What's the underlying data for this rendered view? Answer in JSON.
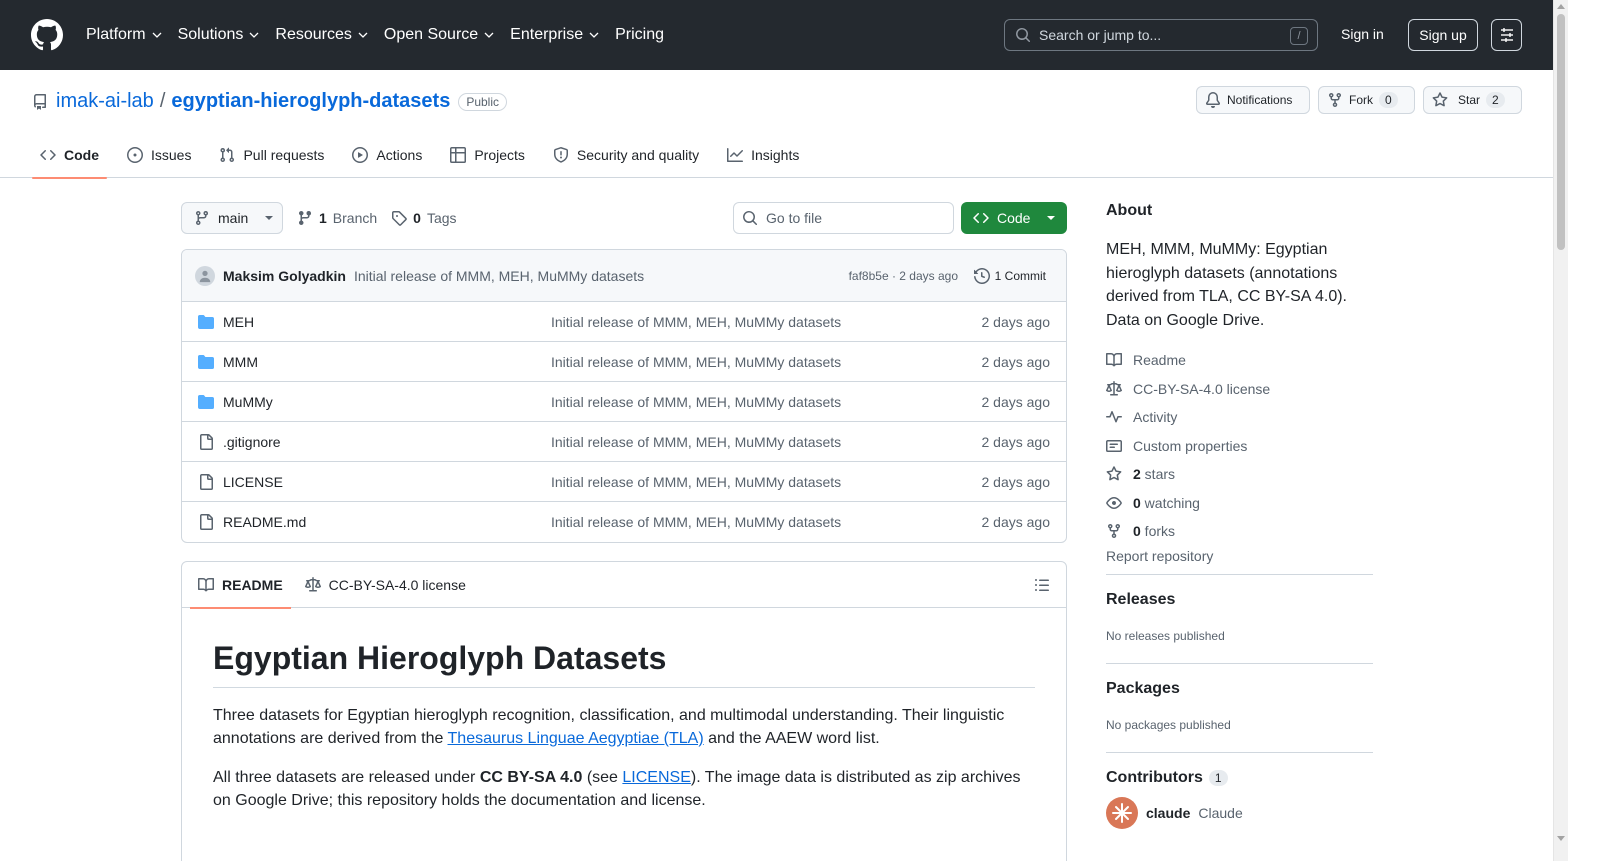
{
  "header": {
    "nav": [
      {
        "label": "Platform",
        "has_menu": true
      },
      {
        "label": "Solutions",
        "has_menu": true
      },
      {
        "label": "Resources",
        "has_menu": true
      },
      {
        "label": "Open Source",
        "has_menu": true
      },
      {
        "label": "Enterprise",
        "has_menu": true
      },
      {
        "label": "Pricing",
        "has_menu": false
      }
    ],
    "search_placeholder": "Search or jump to...",
    "search_shortcut": "/",
    "sign_in": "Sign in",
    "sign_up": "Sign up"
  },
  "repo": {
    "owner": "imak-ai-lab",
    "separator": "/",
    "name": "egyptian-hieroglyph-datasets",
    "visibility": "Public",
    "actions": {
      "notifications": "Notifications",
      "fork": "Fork",
      "fork_count": "0",
      "star": "Star",
      "star_count": "2"
    },
    "tabs": [
      {
        "label": "Code",
        "icon": "code-icon",
        "active": true
      },
      {
        "label": "Issues",
        "icon": "issue-icon",
        "active": false
      },
      {
        "label": "Pull requests",
        "icon": "pull-request-icon",
        "active": false
      },
      {
        "label": "Actions",
        "icon": "play-icon",
        "active": false
      },
      {
        "label": "Projects",
        "icon": "table-icon",
        "active": false
      },
      {
        "label": "Security and quality",
        "icon": "shield-icon",
        "active": false
      },
      {
        "label": "Insights",
        "icon": "graph-icon",
        "active": false
      }
    ]
  },
  "toolbar": {
    "branch": "main",
    "branch_count": "1",
    "branch_label": "Branch",
    "tag_count": "0",
    "tag_label": "Tags",
    "goto_placeholder": "Go to file",
    "code_button": "Code"
  },
  "commit": {
    "author": "Maksim Golyadkin",
    "message": "Initial release of MMM, MEH, MuMMy datasets",
    "hash": "faf8b5e",
    "time": "2 days ago",
    "hash_time": "faf8b5e · 2 days ago",
    "commit_count_label": "1 Commit"
  },
  "files": [
    {
      "name": "MEH",
      "type": "folder",
      "message": "Initial release of MMM, MEH, MuMMy datasets",
      "date": "2 days ago"
    },
    {
      "name": "MMM",
      "type": "folder",
      "message": "Initial release of MMM, MEH, MuMMy datasets",
      "date": "2 days ago"
    },
    {
      "name": "MuMMy",
      "type": "folder",
      "message": "Initial release of MMM, MEH, MuMMy datasets",
      "date": "2 days ago"
    },
    {
      "name": ".gitignore",
      "type": "file",
      "message": "Initial release of MMM, MEH, MuMMy datasets",
      "date": "2 days ago"
    },
    {
      "name": "LICENSE",
      "type": "file",
      "message": "Initial release of MMM, MEH, MuMMy datasets",
      "date": "2 days ago"
    },
    {
      "name": "README.md",
      "type": "file",
      "message": "Initial release of MMM, MEH, MuMMy datasets",
      "date": "2 days ago"
    }
  ],
  "readme": {
    "tab_readme": "README",
    "tab_license": "CC-BY-SA-4.0 license",
    "title": "Egyptian Hieroglyph Datasets",
    "p1_before": "Three datasets for Egyptian hieroglyph recognition, classification, and multimodal understanding. Their linguistic annotations are derived from the ",
    "p1_link": "Thesaurus Linguae Aegyptiae (TLA)",
    "p1_after": " and the AAEW word list.",
    "p2_before": "All three datasets are released under ",
    "p2_bold": "CC BY-SA 4.0",
    "p2_mid": " (see ",
    "p2_link": "LICENSE",
    "p2_after": "). The image data is distributed as zip archives on Google Drive; this repository holds the documentation and license."
  },
  "sidebar": {
    "about_heading": "About",
    "description": "MEH, MMM, MuMMy: Egyptian hieroglyph datasets (annotations derived from TLA, CC BY-SA 4.0). Data on Google Drive.",
    "links": [
      {
        "icon": "book-icon",
        "label": "Readme",
        "bold": ""
      },
      {
        "icon": "law-icon",
        "label": "CC-BY-SA-4.0 license",
        "bold": ""
      },
      {
        "icon": "pulse-icon",
        "label": "Activity",
        "bold": ""
      },
      {
        "icon": "note-icon",
        "label": "Custom properties",
        "bold": ""
      },
      {
        "icon": "star-icon",
        "label": " stars",
        "bold": "2"
      },
      {
        "icon": "eye-icon",
        "label": " watching",
        "bold": "0"
      },
      {
        "icon": "fork-icon",
        "label": " forks",
        "bold": "0"
      }
    ],
    "report": "Report repository",
    "releases_heading": "Releases",
    "releases_text": "No releases published",
    "packages_heading": "Packages",
    "packages_text": "No packages published",
    "contributors_heading": "Contributors",
    "contributors_count": "1",
    "contributor_login": "claude",
    "contributor_name": "Claude"
  },
  "colors": {
    "header_bg": "#24292f",
    "link": "#0969da",
    "primary_button": "#1f883d",
    "active_tab_underline": "#fd8c73",
    "folder": "#54aeff"
  }
}
